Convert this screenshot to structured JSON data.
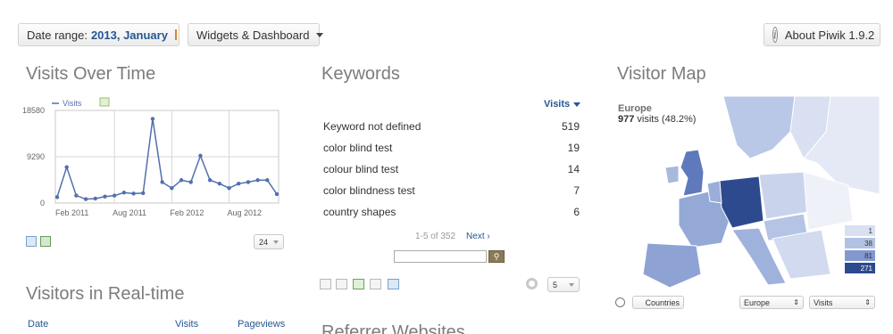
{
  "toolbar": {
    "date_range_label": "Date range:",
    "date_range_value": "2013, January",
    "widgets_label": "Widgets & Dashboard",
    "about_label": "About Piwik 1.9.2"
  },
  "visits_over_time": {
    "title": "Visits Over Time",
    "limit_value": "24"
  },
  "chart_data": {
    "type": "line",
    "title": "",
    "series": [
      {
        "name": "Visits",
        "color": "#5170ae",
        "values": [
          1200,
          7200,
          1500,
          800,
          900,
          1300,
          1500,
          2100,
          1900,
          2000,
          16900,
          4200,
          3000,
          4600,
          4200,
          9500,
          4600,
          3900,
          3000,
          3900,
          4200,
          4600,
          4600,
          1800
        ]
      }
    ],
    "x_tick_labels": [
      "Feb 2011",
      "Aug 2011",
      "Feb 2012",
      "Aug 2012"
    ],
    "y_tick_labels": [
      "18580",
      "9290",
      "0"
    ],
    "ylim": [
      0,
      18580
    ],
    "grid": true
  },
  "keywords": {
    "title": "Keywords",
    "column_header": "Visits",
    "rows": [
      {
        "keyword": "Keyword not defined",
        "visits": "519"
      },
      {
        "keyword": "color blind test",
        "visits": "19"
      },
      {
        "keyword": "colour blind test",
        "visits": "14"
      },
      {
        "keyword": "color blindness test",
        "visits": "7"
      },
      {
        "keyword": "country shapes",
        "visits": "6"
      }
    ],
    "pager_range": "1-5 of 352",
    "next_label": "Next ›",
    "limit_value": "5"
  },
  "visitor_map": {
    "title": "Visitor Map",
    "region": "Europe",
    "visits_count": "977",
    "visits_rest": "visits (48.2%)",
    "legend": [
      "1",
      "38",
      "81",
      "271"
    ],
    "countries_label": "Countries",
    "region_select": "Europe",
    "metric_select": "Visits"
  },
  "realtime": {
    "title": "Visitors in Real-time",
    "columns": [
      "Date",
      "Visits",
      "Pageviews"
    ]
  },
  "referrers": {
    "title": "Referrer Websites"
  }
}
